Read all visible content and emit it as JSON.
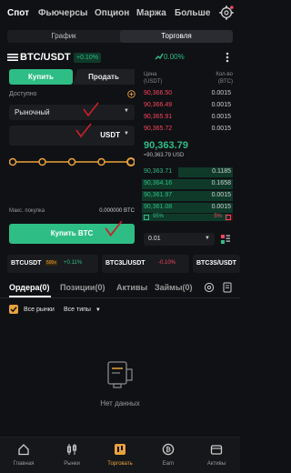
{
  "top_tabs": [
    "Спот",
    "Фьючерсы",
    "Опцион",
    "Маржа",
    "Больше"
  ],
  "segment": {
    "chart": "График",
    "trade": "Торговля"
  },
  "pair": {
    "name": "BTC/USDT",
    "change_badge": "+0.10%",
    "change_pct": "0.00%"
  },
  "order_form": {
    "buy_tab": "Купить",
    "sell_tab": "Продать",
    "available_label": "Доступно",
    "order_type": "Рыночный",
    "amount_unit": "USDT",
    "max_buy_label": "Макс. покупка",
    "max_buy_value": "0.000000 BTC",
    "submit_label": "Купить BTC"
  },
  "orderbook": {
    "price_header": "Цена\n(USDT)",
    "qty_header": "Кол-во\n(BTC)",
    "asks": [
      {
        "price": "90,366.50",
        "qty": "0.0015"
      },
      {
        "price": "90,366.49",
        "qty": "0.0015"
      },
      {
        "price": "90,365.91",
        "qty": "0.0015"
      },
      {
        "price": "90,365.72",
        "qty": "0.0015"
      }
    ],
    "mid_price": "90,363.79",
    "mid_usd": "≈90,363.79 USD",
    "bids": [
      {
        "price": "90,363.71",
        "qty": "0.1185"
      },
      {
        "price": "90,364.16",
        "qty": "0.1658"
      },
      {
        "price": "90,361.97",
        "qty": "0.0015"
      },
      {
        "price": "90,361.08",
        "qty": "0.0015"
      }
    ],
    "buy_ratio": "95%",
    "sell_ratio": "5%",
    "precision": "0.01"
  },
  "tickers": [
    {
      "name": "BTCUSDT",
      "lev": "500x",
      "change": "+0.11%"
    },
    {
      "name": "BTC3L/USDT",
      "lev": "",
      "change": "-0.10%"
    },
    {
      "name": "BTC3S/USDT",
      "lev": "",
      "change": ""
    }
  ],
  "orders": {
    "tabs": [
      "Ордера(0)",
      "Позиции(0)",
      "Активы",
      "Займы(0)"
    ],
    "all_markets": "Все рынки",
    "all_types": "Все типы",
    "empty_text": "Нет данных"
  },
  "bottom_nav": [
    "Главная",
    "Рынки",
    "Торговать",
    "Earn",
    "Активы"
  ],
  "colors": {
    "green": "#2ebd85",
    "red": "#f6465d",
    "accent": "#e9a23b"
  }
}
